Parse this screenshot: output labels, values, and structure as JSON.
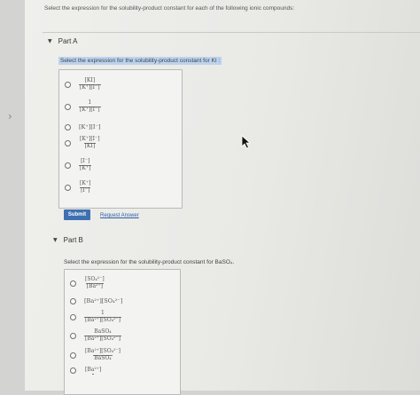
{
  "question": "Select the expression for the solubility-product constant for each of the following ionic compounds:",
  "part_a": {
    "title": "Part A",
    "prompt": "Select the expression for the solubility-product constant for KI :",
    "options": [
      {
        "type": "frac",
        "num": "[KI]",
        "den": "[K⁺][I⁻]"
      },
      {
        "type": "frac",
        "num": "1",
        "den": "[K⁺][I⁻]"
      },
      {
        "type": "text",
        "text": "[K⁺][I⁻]"
      },
      {
        "type": "frac",
        "num": "[K⁺][I⁻]",
        "den": "[KI]"
      },
      {
        "type": "frac",
        "num": "[I⁻]",
        "den": "[K⁺]"
      },
      {
        "type": "frac",
        "num": "[K⁺]",
        "den": "[I⁻]"
      }
    ],
    "submit_label": "Submit",
    "request_label": "Request Answer"
  },
  "part_b": {
    "title": "Part B",
    "prompt": "Select the expression for the solubility-product constant for BaSO₄.",
    "options": [
      {
        "type": "frac",
        "num": "[SO₄²⁻]",
        "den": "[Ba²⁺]"
      },
      {
        "type": "text",
        "text": "[Ba²⁺][SO₄²⁻]"
      },
      {
        "type": "frac",
        "num": "1",
        "den": "[Ba²⁺][SO₄²⁻]"
      },
      {
        "type": "frac",
        "num": "BaSO₄",
        "den": "[Ba²⁺][SO₄²⁻]"
      },
      {
        "type": "frac",
        "num": "[Ba²⁺][SO₄²⁻]",
        "den": "BaSO₄"
      },
      {
        "type": "frac",
        "num": "[Ba²⁺]",
        "den": ""
      }
    ]
  }
}
